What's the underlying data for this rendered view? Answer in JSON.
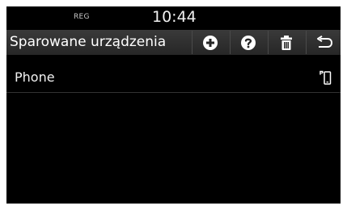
{
  "status_bar": {
    "region": "REG",
    "time": "10:44"
  },
  "header": {
    "title": "Sparowane urządzenia",
    "buttons": [
      {
        "name": "add",
        "icon": "plus-circle-icon"
      },
      {
        "name": "help",
        "icon": "question-circle-icon"
      },
      {
        "name": "delete",
        "icon": "trash-icon"
      },
      {
        "name": "back",
        "icon": "back-arrow-icon"
      }
    ]
  },
  "devices": [
    {
      "label": "Phone",
      "icon": "phone-connection-icon"
    }
  ],
  "colors": {
    "screen_background": "#000000",
    "header_background": "#303030",
    "text": "#ffffff",
    "divider": "#333333"
  }
}
